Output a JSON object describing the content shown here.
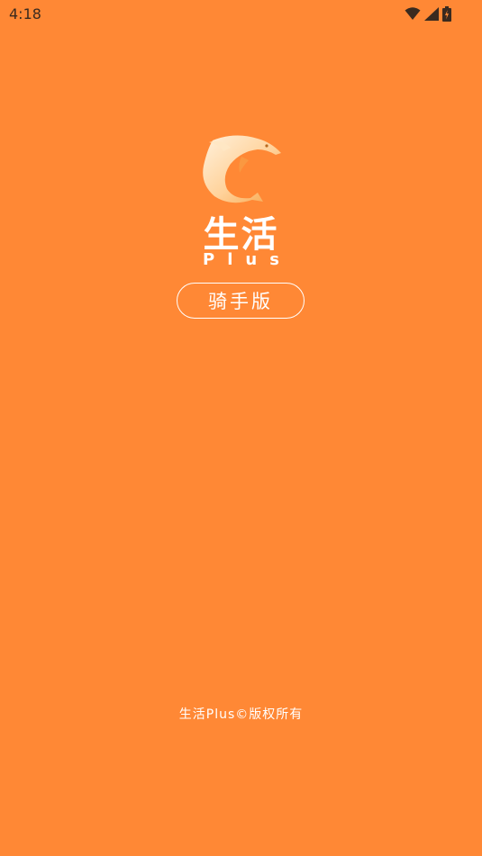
{
  "status_bar": {
    "time": "4:18",
    "icons": [
      "wifi-icon",
      "signal-icon",
      "battery-icon"
    ]
  },
  "brand": {
    "name_cn": "生活",
    "name_plus": "Plus",
    "edition_badge": "骑手版"
  },
  "footer": {
    "copyright": "生活Plus©版权所有"
  },
  "colors": {
    "background": "#FF8835",
    "foreground": "#FFFFFF"
  }
}
